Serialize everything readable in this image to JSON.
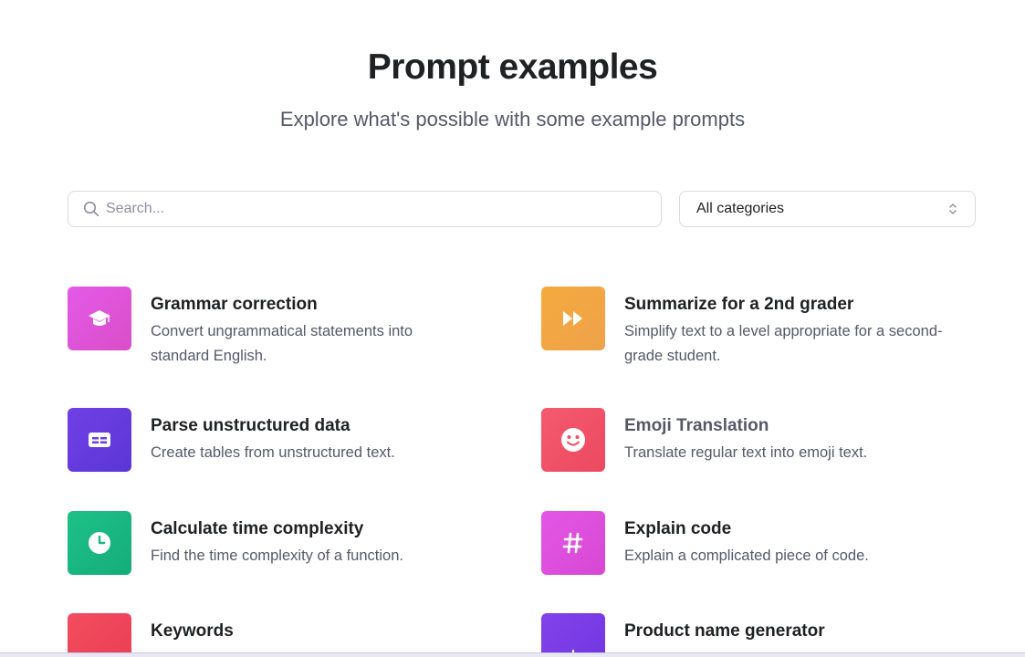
{
  "header": {
    "title": "Prompt examples",
    "subtitle": "Explore what's possible with some example prompts"
  },
  "search": {
    "placeholder": "Search...",
    "value": ""
  },
  "category_filter": {
    "selected": "All categories"
  },
  "cards": [
    {
      "title": "Grammar correction",
      "description": "Convert ungrammatical statements into standard English.",
      "icon": "graduation-cap-icon",
      "color": "#d946ef"
    },
    {
      "title": "Summarize for a 2nd grader",
      "description": "Simplify text to a level appropriate for a second-grade student.",
      "icon": "fast-forward-icon",
      "color": "#f2a33a"
    },
    {
      "title": "Parse unstructured data",
      "description": "Create tables from unstructured text.",
      "icon": "table-icon",
      "color": "#6d3ae0"
    },
    {
      "title": "Emoji Translation",
      "description": "Translate regular text into emoji text.",
      "icon": "smiley-icon",
      "color": "#f0536a"
    },
    {
      "title": "Calculate time complexity",
      "description": "Find the time complexity of a function.",
      "icon": "clock-icon",
      "color": "#19b881"
    },
    {
      "title": "Explain code",
      "description": "Explain a complicated piece of code.",
      "icon": "hashtag-icon",
      "color": "#de4ee0"
    },
    {
      "title": "Keywords",
      "description": "",
      "icon": "key-icon",
      "color": "#f0455a"
    },
    {
      "title": "Product name generator",
      "description": "",
      "icon": "lightbulb-icon",
      "color": "#7c3ae8"
    }
  ]
}
